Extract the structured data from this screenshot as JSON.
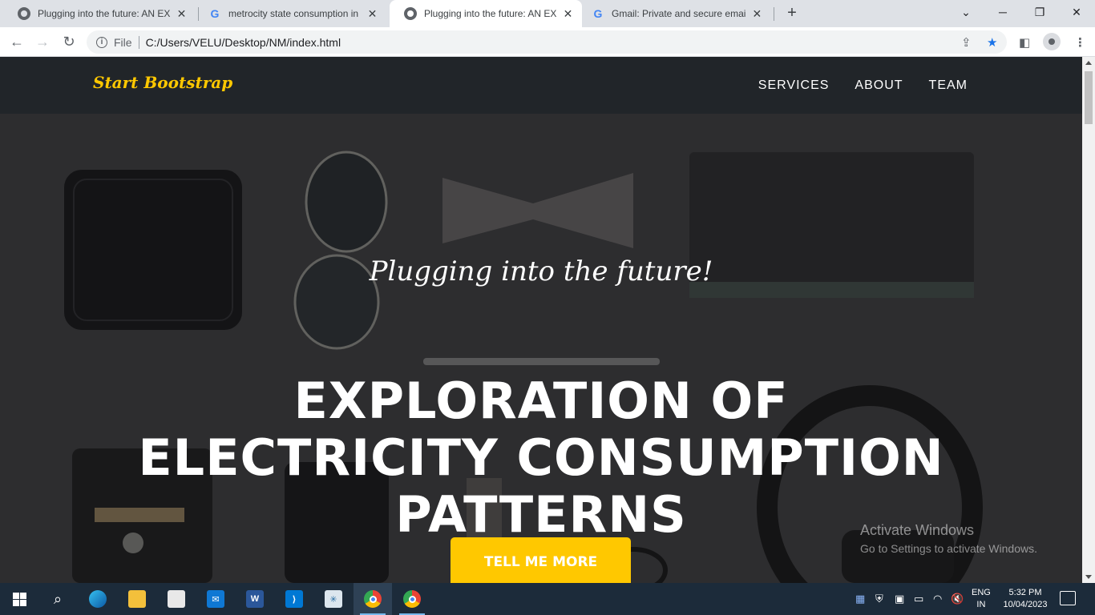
{
  "browser": {
    "tabs": [
      {
        "title": "Plugging into the future: AN EXPLORATION",
        "icon": "globe-icon",
        "active": false
      },
      {
        "title": "metrocity state consumption in india",
        "icon": "google-icon",
        "active": false
      },
      {
        "title": "Plugging into the future: AN EXPLORATION",
        "icon": "globe-icon",
        "active": true
      },
      {
        "title": "Gmail: Private and secure email at no cost",
        "icon": "google-icon",
        "active": false
      }
    ],
    "close_glyph": "✕",
    "new_tab_glyph": "+",
    "address": {
      "scheme": "File",
      "url": "C:/Users/VELU/Desktop/NM/index.html"
    }
  },
  "site": {
    "brand": "Start Bootstrap",
    "nav": [
      "SERVICES",
      "ABOUT",
      "TEAM"
    ],
    "subheading": "Plugging into the future!",
    "heading_lines": [
      "EXPLORATION OF",
      "ELECTRICITY CONSUMPTION",
      "PATTERNS"
    ],
    "cta": "TELL ME MORE",
    "accent_color": "#ffc800"
  },
  "watermark": {
    "title": "Activate Windows",
    "subtitle": "Go to Settings to activate Windows."
  },
  "taskbar": {
    "apps": [
      "windows-start",
      "search",
      "edge",
      "file-explorer",
      "microsoft-store",
      "mail",
      "word",
      "vs-code",
      "network-app",
      "chrome",
      "chrome-profile"
    ],
    "language": [
      "ENG",
      "IN"
    ],
    "time": "5:32 PM",
    "date": "10/04/2023"
  }
}
